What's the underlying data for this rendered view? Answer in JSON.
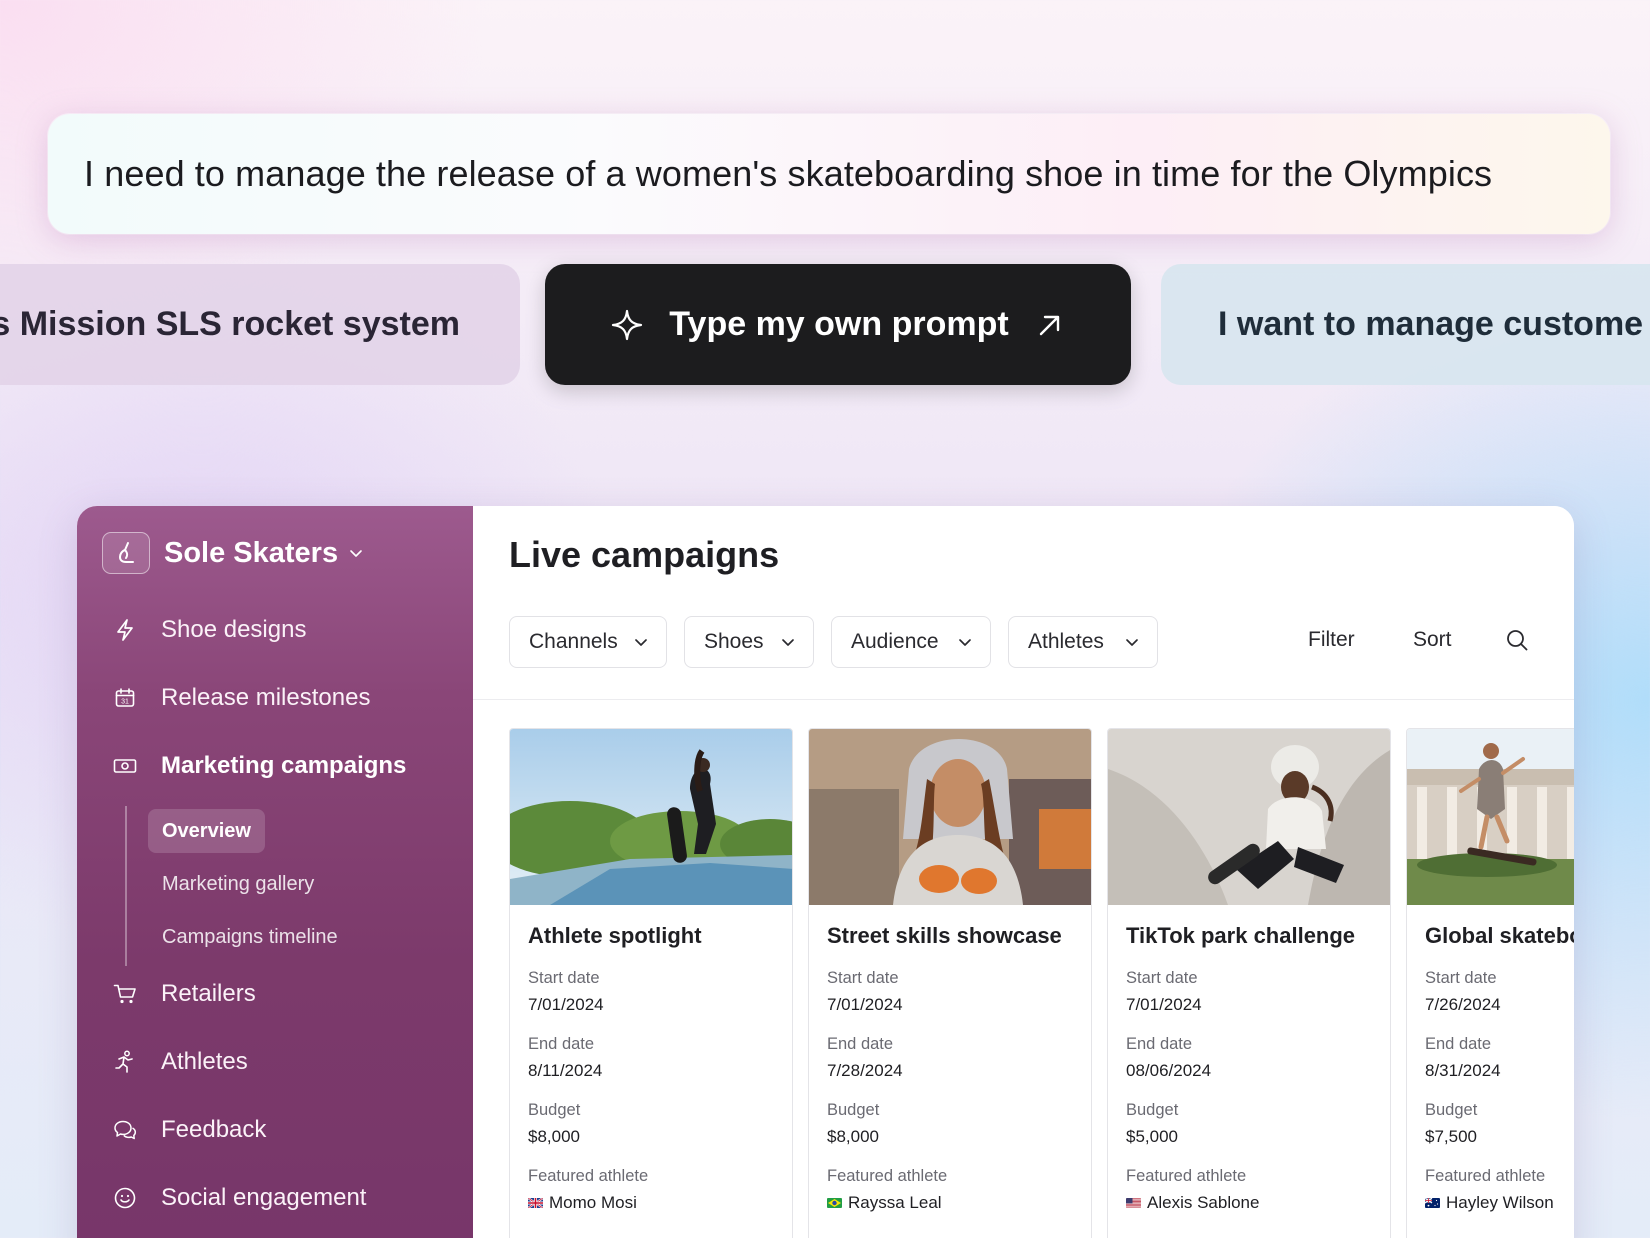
{
  "prompt": {
    "text": "I need to manage the release of a women's skateboarding shoe in time for the Olympics"
  },
  "chips": {
    "left": "s Mission SLS rocket system",
    "own": "Type my own prompt",
    "right": "I want to manage custome"
  },
  "sidebar": {
    "brand": "Sole Skaters",
    "items": [
      {
        "label": "Shoe designs",
        "icon": "lightning-icon"
      },
      {
        "label": "Release milestones",
        "icon": "calendar-icon"
      },
      {
        "label": "Marketing campaigns",
        "icon": "money-icon"
      },
      {
        "label": "Retailers",
        "icon": "cart-icon"
      },
      {
        "label": "Athletes",
        "icon": "runner-icon"
      },
      {
        "label": "Feedback",
        "icon": "chat-icon"
      },
      {
        "label": "Social engagement",
        "icon": "smiley-icon"
      }
    ],
    "subitems": [
      {
        "label": "Overview"
      },
      {
        "label": "Marketing gallery"
      },
      {
        "label": "Campaigns timeline"
      }
    ]
  },
  "main": {
    "title": "Live campaigns",
    "filters": [
      "Channels",
      "Shoes",
      "Audience",
      "Athletes"
    ],
    "filter_label": "Filter",
    "sort_label": "Sort"
  },
  "field_labels": {
    "start": "Start date",
    "end": "End date",
    "budget": "Budget",
    "athlete": "Featured athlete"
  },
  "cards": [
    {
      "title": "Athlete spotlight",
      "start": "7/01/2024",
      "end": "8/11/2024",
      "budget": "$8,000",
      "athlete": "Momo Mosi",
      "flag": "uk"
    },
    {
      "title": "Street skills showcase",
      "start": "7/01/2024",
      "end": "7/28/2024",
      "budget": "$8,000",
      "athlete": "Rayssa Leal",
      "flag": "br"
    },
    {
      "title": "TikTok park challenge",
      "start": "7/01/2024",
      "end": "08/06/2024",
      "budget": "$5,000",
      "athlete": "Alexis Sablone",
      "flag": "us"
    },
    {
      "title": "Global skatebo",
      "start": "7/26/2024",
      "end": "8/31/2024",
      "budget": "$7,500",
      "athlete": "Hayley Wilson",
      "flag": "au"
    }
  ],
  "colors": {
    "sidebar_accent": "#8a4678",
    "chip_dark": "#1c1c1e"
  }
}
